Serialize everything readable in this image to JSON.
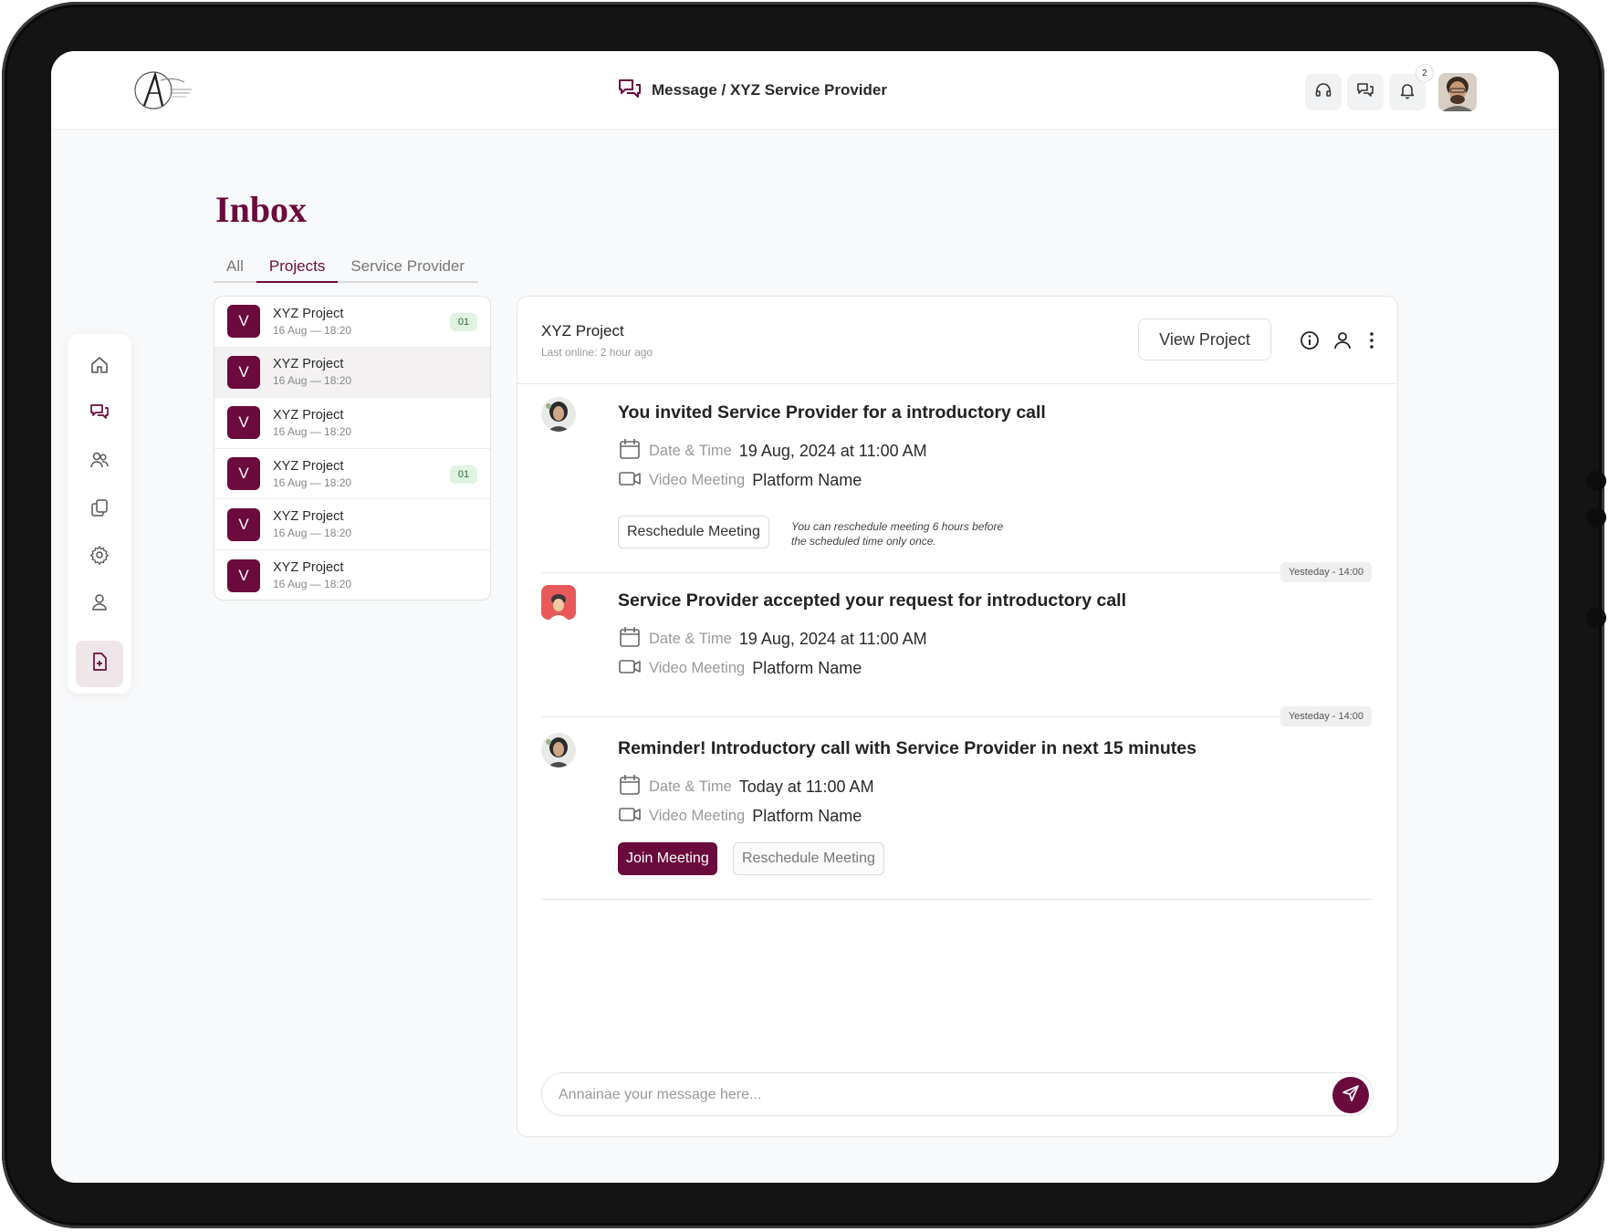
{
  "header": {
    "breadcrumb": "Message / XYZ Service Provider",
    "notification_count": "2"
  },
  "inbox": {
    "title": "Inbox",
    "tabs": [
      {
        "label": "All",
        "active": false
      },
      {
        "label": "Projects",
        "active": true
      },
      {
        "label": "Service Provider",
        "active": false
      }
    ]
  },
  "conversations": [
    {
      "initial": "V",
      "name": "XYZ Project",
      "time": "16 Aug — 18:20",
      "badge": "01",
      "selected": false
    },
    {
      "initial": "V",
      "name": "XYZ Project",
      "time": "16 Aug — 18:20",
      "badge": "",
      "selected": true
    },
    {
      "initial": "V",
      "name": "XYZ Project",
      "time": "16 Aug — 18:20",
      "badge": "",
      "selected": false
    },
    {
      "initial": "V",
      "name": "XYZ Project",
      "time": "16 Aug — 18:20",
      "badge": "01",
      "selected": false
    },
    {
      "initial": "V",
      "name": "XYZ Project",
      "time": "16 Aug — 18:20",
      "badge": "",
      "selected": false
    },
    {
      "initial": "V",
      "name": "XYZ Project",
      "time": "16 Aug — 18:20",
      "badge": "",
      "selected": false
    }
  ],
  "chat": {
    "title": "XYZ Project",
    "last_online": "Last online: 2 hour ago",
    "view_project_label": "View Project",
    "messages": [
      {
        "title": "You invited Service Provider for a introductory call",
        "date_label": "Date & Time",
        "date_value": "19 Aug, 2024 at 11:00 AM",
        "meeting_label": "Video Meeting",
        "meeting_value": "Platform Name",
        "reschedule_label": "Reschedule Meeting",
        "note": "You can reschedule meeting 6 hours before the scheduled time only once."
      },
      {
        "stamp": "Yesteday - 14:00",
        "title": "Service Provider accepted your request for introductory call",
        "date_label": "Date & Time",
        "date_value": "19 Aug, 2024 at 11:00 AM",
        "meeting_label": "Video Meeting",
        "meeting_value": "Platform Name"
      },
      {
        "stamp": "Yesteday - 14:00",
        "title": "Reminder! Introductory call with Service Provider in next 15 minutes",
        "date_label": "Date & Time",
        "date_value": "Today at 11:00 AM",
        "meeting_label": "Video Meeting",
        "meeting_value": "Platform Name",
        "join_label": "Join Meeting",
        "reschedule_label": "Reschedule Meeting"
      }
    ],
    "composer_placeholder": "Annainae your message here..."
  },
  "colors": {
    "brand": "#6b0a3d",
    "badge_bg": "#dff3e0",
    "background": "#f8f9fa"
  },
  "icons": [
    "home-icon",
    "messages-icon",
    "users-icon",
    "documents-icon",
    "settings-icon",
    "profile-icon",
    "add-file-icon",
    "headset-icon",
    "bell-icon",
    "info-icon",
    "person-icon",
    "more-icon",
    "calendar-icon",
    "video-icon",
    "send-icon"
  ]
}
